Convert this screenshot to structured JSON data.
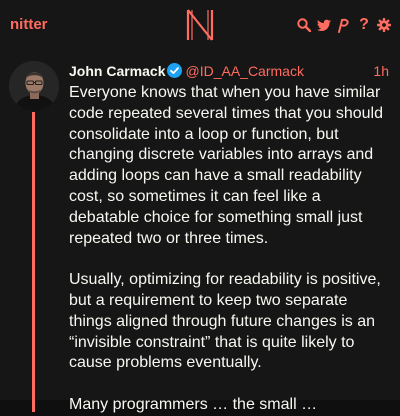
{
  "navbar": {
    "brand": "nitter",
    "logo_icon": "nitter-logo-icon",
    "icons": [
      "search-icon",
      "twitter-bird-icon",
      "rss-icon",
      "info-icon",
      "gear-icon"
    ],
    "rss_glyph": "ℹ",
    "info_glyph": "?"
  },
  "tweet": {
    "fullname": "John Carmack",
    "verified_icon": "verified-badge-icon",
    "username": "@ID_AA_Carmack",
    "date": "1h",
    "content": "Everyone knows that when you have similar code repeated several times that you should consolidate into a loop or function, but changing discrete variables into arrays and adding loops can have a small readability cost, so sometimes it can feel like a debatable choice for something small just repeated two or three times.\n\nUsually, optimizing for readability is positive, but a requirement to keep two separate things aligned through future changes is an “invisible constraint” that is quite likely to cause problems eventually.\n\nMany programmers … the small …"
  },
  "colors": {
    "accent": "#ff6c60",
    "background": "#0f0f0f",
    "panel": "#161616",
    "text": "#f8f8f2",
    "verified": "#1da1f2"
  }
}
